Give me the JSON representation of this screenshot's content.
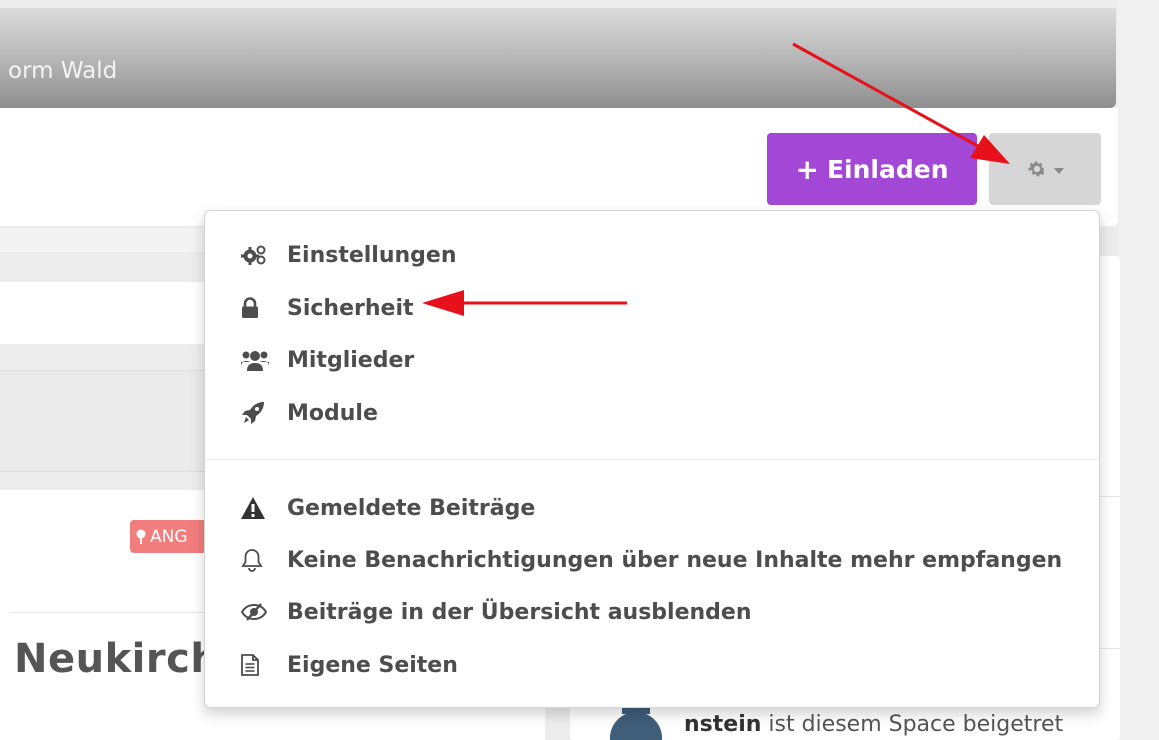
{
  "header": {
    "title": "orm Wald"
  },
  "toolbar": {
    "invite_label": "Einladen",
    "settings_icon": "gear-icon"
  },
  "menu": {
    "items": [
      {
        "label": "Einstellungen",
        "icon": "cogs-icon"
      },
      {
        "label": "Sicherheit",
        "icon": "lock-icon"
      },
      {
        "label": "Mitglieder",
        "icon": "users-icon"
      },
      {
        "label": "Module",
        "icon": "rocket-icon"
      },
      {
        "label": "Gemeldete Beiträge",
        "icon": "warning-icon"
      },
      {
        "label": "Keine Benachrichtigungen über neue Inhalte mehr empfangen",
        "icon": "bell-icon"
      },
      {
        "label": "Beiträge in der Übersicht ausblenden",
        "icon": "eye-slash-icon"
      },
      {
        "label": "Eigene Seiten",
        "icon": "file-text-icon"
      }
    ]
  },
  "content": {
    "badge": "ANG",
    "heading": "Neukirch"
  },
  "activity": {
    "user": "nstein",
    "text": " ist diesem Space beigetret"
  },
  "colors": {
    "accent": "#a247d6",
    "arrow": "#e8101a",
    "badge": "#f27d7d"
  }
}
